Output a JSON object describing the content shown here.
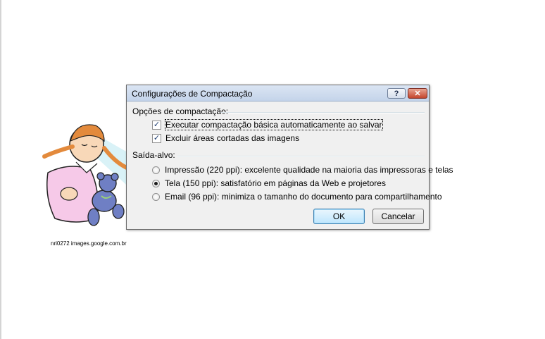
{
  "clipart": {
    "caption": "nri0272 images.google.com.br"
  },
  "dialog": {
    "title": "Configurações de Compactação",
    "help_label": "?",
    "close_label": "✕",
    "options_section": "Opções de compactação:",
    "options": [
      {
        "label": "Executar compactação básica automaticamente ao salvar",
        "checked": true
      },
      {
        "label": "Excluir áreas cortadas das imagens",
        "checked": true
      }
    ],
    "target_section": "Saída-alvo:",
    "targets": [
      {
        "label": "Impressão (220 ppi): excelente qualidade na maioria das impressoras e telas",
        "selected": false
      },
      {
        "label": "Tela (150 ppi): satisfatório em páginas da Web e projetores",
        "selected": true
      },
      {
        "label": "Email (96 ppi): minimiza o tamanho do documento para compartilhamento",
        "selected": false
      }
    ],
    "ok_label": "OK",
    "cancel_label": "Cancelar"
  }
}
